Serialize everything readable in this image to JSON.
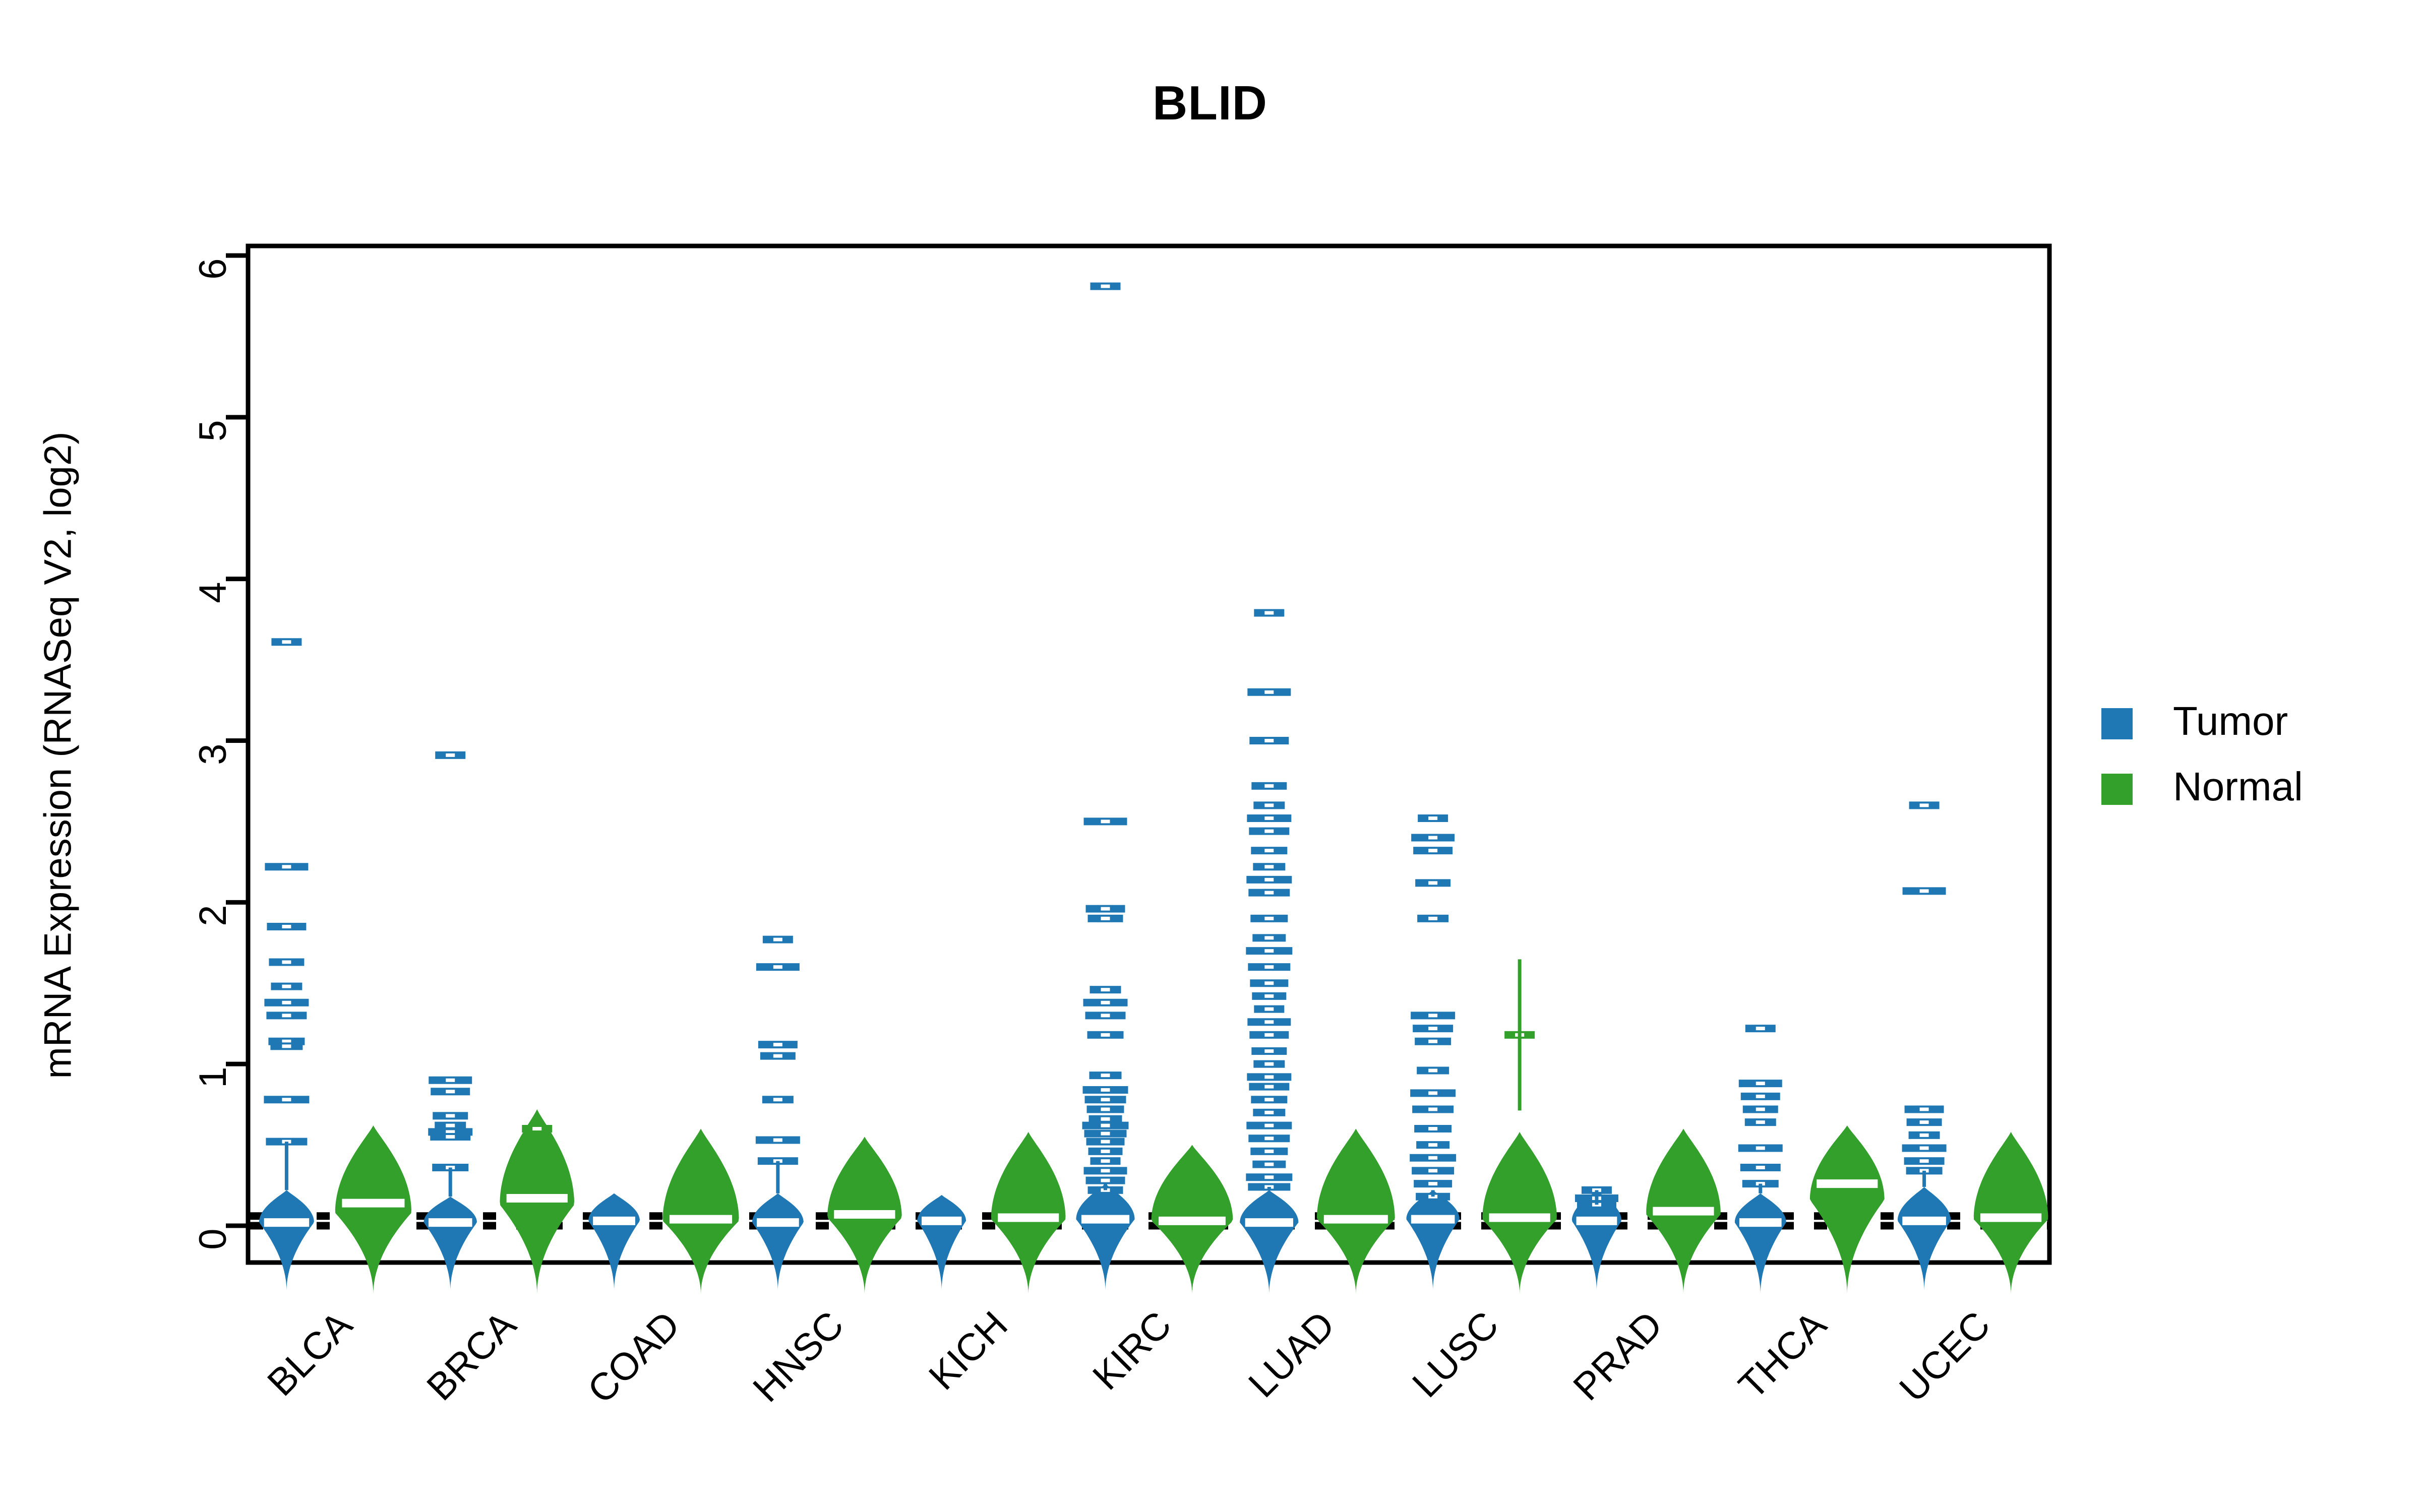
{
  "chart_data": {
    "type": "violin",
    "title": "BLID",
    "xlabel": "",
    "ylabel": "mRNA Expression (RNASeq V2, log2)",
    "ylim": [
      -0.45,
      6.2
    ],
    "yticks": [
      0,
      1,
      2,
      3,
      4,
      5,
      6
    ],
    "ytick_labels": [
      "0",
      "1",
      "2",
      "3",
      "4",
      "5",
      "6"
    ],
    "grid": false,
    "legend_position": "right",
    "reference_lines": [
      0.06,
      0.0
    ],
    "categories": [
      "BLCA",
      "BRCA",
      "COAD",
      "HNSC",
      "KICH",
      "KIRC",
      "LUAD",
      "LUSC",
      "PRAD",
      "THCA",
      "UCEC"
    ],
    "series": [
      {
        "name": "Tumor",
        "color": "#1f78b4",
        "groups": [
          {
            "category": "BLCA",
            "median": 0.02,
            "violin_top": 0.22,
            "violin_bottom": -0.4,
            "violin_peak": 0.02,
            "violin_halfwidth": 0.62,
            "outliers": [
              3.61,
              2.22,
              1.85,
              1.63,
              1.48,
              1.38,
              1.3,
              1.14,
              1.11,
              0.78,
              0.52
            ]
          },
          {
            "category": "BRCA",
            "median": 0.02,
            "violin_top": 0.18,
            "violin_bottom": -0.4,
            "violin_peak": 0.02,
            "violin_halfwidth": 0.6,
            "outliers": [
              2.91,
              0.9,
              0.83,
              0.68,
              0.62,
              0.58,
              0.55,
              0.36
            ]
          },
          {
            "category": "COAD",
            "median": 0.03,
            "violin_top": 0.2,
            "violin_bottom": -0.4,
            "violin_peak": 0.03,
            "violin_halfwidth": 0.58,
            "outliers": []
          },
          {
            "category": "HNSC",
            "median": 0.02,
            "violin_top": 0.2,
            "violin_bottom": -0.4,
            "violin_peak": 0.02,
            "violin_halfwidth": 0.58,
            "outliers": [
              1.77,
              1.6,
              1.12,
              1.05,
              0.78,
              0.53,
              0.4
            ]
          },
          {
            "category": "KICH",
            "median": 0.03,
            "violin_top": 0.19,
            "violin_bottom": -0.4,
            "violin_peak": 0.03,
            "violin_halfwidth": 0.55,
            "outliers": []
          },
          {
            "category": "KIRC",
            "median": 0.04,
            "violin_top": 0.26,
            "violin_bottom": -0.4,
            "violin_peak": 0.04,
            "violin_halfwidth": 0.66,
            "outliers": [
              5.81,
              2.5,
              1.96,
              1.9,
              1.46,
              1.38,
              1.3,
              1.18,
              0.93,
              0.84,
              0.78,
              0.72,
              0.66,
              0.62,
              0.57,
              0.52,
              0.46,
              0.4,
              0.34,
              0.28,
              0.22
            ]
          },
          {
            "category": "LUAD",
            "median": 0.02,
            "violin_top": 0.22,
            "violin_bottom": -0.42,
            "violin_peak": 0.02,
            "violin_halfwidth": 0.66,
            "outliers": [
              3.79,
              3.3,
              3.0,
              2.72,
              2.6,
              2.52,
              2.44,
              2.32,
              2.22,
              2.14,
              2.06,
              1.9,
              1.78,
              1.7,
              1.6,
              1.5,
              1.42,
              1.34,
              1.26,
              1.18,
              1.08,
              1.0,
              0.92,
              0.86,
              0.78,
              0.7,
              0.62,
              0.54,
              0.46,
              0.38,
              0.3,
              0.24
            ]
          },
          {
            "category": "LUSC",
            "median": 0.04,
            "violin_top": 0.22,
            "violin_bottom": -0.4,
            "violin_peak": 0.04,
            "violin_halfwidth": 0.6,
            "outliers": [
              2.52,
              2.4,
              2.32,
              2.12,
              1.9,
              1.3,
              1.22,
              1.14,
              0.96,
              0.82,
              0.72,
              0.6,
              0.5,
              0.42,
              0.34,
              0.26,
              0.18
            ]
          },
          {
            "category": "PRAD",
            "median": 0.03,
            "violin_top": 0.22,
            "violin_bottom": -0.4,
            "violin_peak": 0.03,
            "violin_halfwidth": 0.56,
            "outliers": [
              0.22,
              0.17,
              0.13
            ]
          },
          {
            "category": "THCA",
            "median": 0.02,
            "violin_top": 0.2,
            "violin_bottom": -0.42,
            "violin_peak": 0.02,
            "violin_halfwidth": 0.58,
            "outliers": [
              1.22,
              0.88,
              0.8,
              0.72,
              0.64,
              0.48,
              0.36,
              0.26
            ]
          },
          {
            "category": "UCEC",
            "median": 0.03,
            "violin_top": 0.24,
            "violin_bottom": -0.4,
            "violin_peak": 0.03,
            "violin_halfwidth": 0.6,
            "outliers": [
              2.6,
              2.07,
              0.72,
              0.64,
              0.56,
              0.48,
              0.4,
              0.34
            ]
          }
        ]
      },
      {
        "name": "Normal",
        "color": "#33a02c",
        "groups": [
          {
            "category": "BLCA",
            "median": 0.14,
            "violin_top": 0.62,
            "violin_bottom": -0.42,
            "violin_peak": 0.08,
            "violin_halfwidth": 0.86,
            "outliers": []
          },
          {
            "category": "BRCA",
            "median": 0.17,
            "violin_top": 0.72,
            "violin_bottom": -0.42,
            "violin_peak": 0.13,
            "violin_halfwidth": 0.84,
            "outliers": [
              0.6
            ]
          },
          {
            "category": "COAD",
            "median": 0.04,
            "violin_top": 0.6,
            "violin_bottom": -0.42,
            "violin_peak": 0.03,
            "violin_halfwidth": 0.86,
            "outliers": []
          },
          {
            "category": "HNSC",
            "median": 0.07,
            "violin_top": 0.55,
            "violin_bottom": -0.42,
            "violin_peak": 0.05,
            "violin_halfwidth": 0.84,
            "outliers": []
          },
          {
            "category": "KICH",
            "median": 0.05,
            "violin_top": 0.58,
            "violin_bottom": -0.42,
            "violin_peak": 0.04,
            "violin_halfwidth": 0.84,
            "outliers": []
          },
          {
            "category": "KIRC",
            "median": 0.03,
            "violin_top": 0.5,
            "violin_bottom": -0.42,
            "violin_peak": 0.03,
            "violin_halfwidth": 0.92,
            "outliers": []
          },
          {
            "category": "LUAD",
            "median": 0.04,
            "violin_top": 0.6,
            "violin_bottom": -0.42,
            "violin_peak": 0.04,
            "violin_halfwidth": 0.88,
            "outliers": []
          },
          {
            "category": "LUSC",
            "median": 0.05,
            "violin_top": 0.58,
            "violin_bottom": -0.42,
            "violin_peak": 0.04,
            "violin_halfwidth": 0.84,
            "outliers": [
              1.18
            ]
          },
          {
            "category": "PRAD",
            "median": 0.09,
            "violin_top": 0.6,
            "violin_bottom": -0.42,
            "violin_peak": 0.07,
            "violin_halfwidth": 0.84,
            "outliers": []
          },
          {
            "category": "THCA",
            "median": 0.26,
            "violin_top": 0.62,
            "violin_bottom": -0.42,
            "violin_peak": 0.16,
            "violin_halfwidth": 0.84,
            "outliers": []
          },
          {
            "category": "UCEC",
            "median": 0.05,
            "violin_top": 0.58,
            "violin_bottom": -0.42,
            "violin_peak": 0.04,
            "violin_halfwidth": 0.84,
            "outliers": []
          }
        ]
      }
    ]
  },
  "title": {
    "text": "BLID"
  },
  "axes": {
    "y_title": "mRNA Expression (RNASeq V2, log2)",
    "y_ticks": [
      "0",
      "1",
      "2",
      "3",
      "4",
      "5",
      "6"
    ],
    "x_ticks": [
      "BLCA",
      "BRCA",
      "COAD",
      "HNSC",
      "KICH",
      "KIRC",
      "LUAD",
      "LUSC",
      "PRAD",
      "THCA",
      "UCEC"
    ]
  },
  "legend": {
    "items": [
      {
        "label": "Tumor",
        "color": "#1f78b4"
      },
      {
        "label": "Normal",
        "color": "#33a02c"
      }
    ]
  }
}
